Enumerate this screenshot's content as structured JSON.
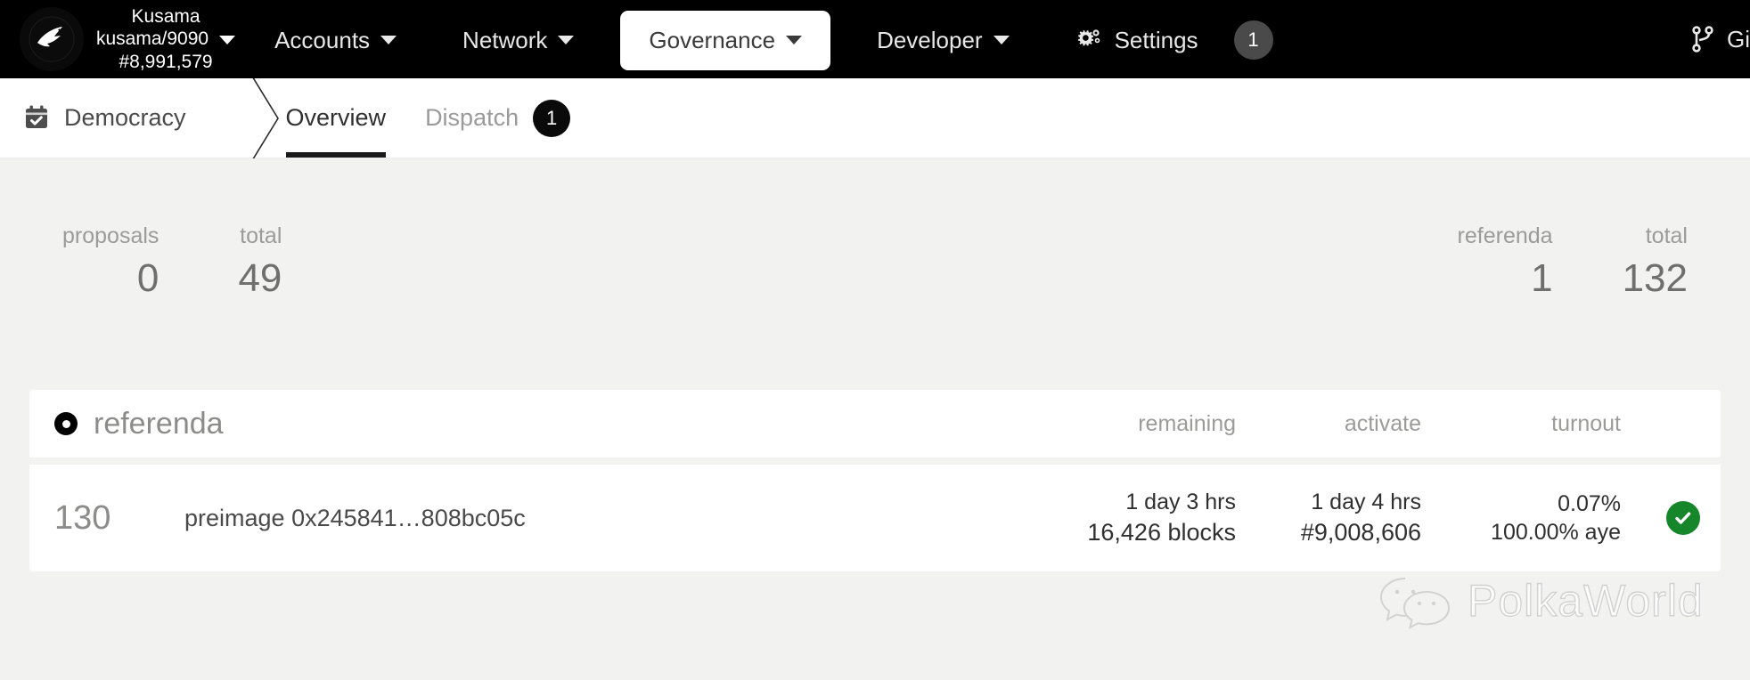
{
  "topnav": {
    "logo_icon": "kusama-bird-logo",
    "chain_name": "Kusama",
    "chain_endpoint": "kusama/9090",
    "block_number": "#8,991,579",
    "items": [
      {
        "label": "Accounts",
        "icon": "chevron-down-icon",
        "active": false
      },
      {
        "label": "Network",
        "icon": "chevron-down-icon",
        "active": false
      },
      {
        "label": "Governance",
        "icon": "chevron-down-icon",
        "active": true
      },
      {
        "label": "Developer",
        "icon": "chevron-down-icon",
        "active": false
      }
    ],
    "settings_label": "Settings",
    "settings_icon": "gear-icon",
    "settings_badge": "1",
    "right_icon": "git-branch-icon",
    "right_label": "Gi"
  },
  "subnav": {
    "breadcrumb_icon": "calendar-check-icon",
    "breadcrumb_label": "Democracy",
    "tabs": [
      {
        "label": "Overview",
        "active": true,
        "badge": ""
      },
      {
        "label": "Dispatch",
        "active": false,
        "badge": "1"
      }
    ]
  },
  "summary": {
    "left": [
      {
        "label": "proposals",
        "value": "0"
      },
      {
        "label": "total",
        "value": "49"
      }
    ],
    "right": [
      {
        "label": "referenda",
        "value": "1"
      },
      {
        "label": "total",
        "value": "132"
      }
    ]
  },
  "table": {
    "icon": "dot-circle-icon",
    "title": "referenda",
    "columns": {
      "remaining": "remaining",
      "activate": "activate",
      "turnout": "turnout"
    },
    "rows": [
      {
        "id": "130",
        "preimage": "preimage 0x245841…808bc05c",
        "remaining_time": "1 day 3 hrs",
        "remaining_blocks": "16,426 blocks",
        "activate_time": "1 day 4 hrs",
        "activate_block": "#9,008,606",
        "turnout_pct": "0.07%",
        "turnout_aye": "100.00% aye",
        "status_icon": "check-circle-icon",
        "status_color": "#15862a"
      }
    ]
  },
  "watermark": {
    "icon": "wechat-logo",
    "text": "PolkaWorld"
  },
  "colors": {
    "nav_bg": "#000000",
    "page_bg": "#f2f2f0",
    "card_bg": "#ffffff",
    "muted_text": "#9b9b99",
    "body_text": "#2f2f2f",
    "accent_green": "#15862a"
  }
}
